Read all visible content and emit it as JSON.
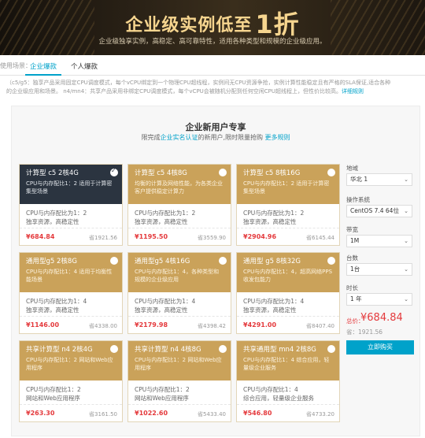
{
  "banner": {
    "headline": "企业级实例低至",
    "headline_big": "1折",
    "subtitle": "企业级独享实例，高稳定、高可靠特性，适用各种类型和规模的企业级应用。"
  },
  "tabs": {
    "prefix": "使用场景：",
    "items": [
      {
        "label": "企业爆款"
      },
      {
        "label": "个人爆款"
      }
    ]
  },
  "notice": {
    "line1": "（c5/g5：独享产品采用固定CPU调度模式，每个vCPU绑定到一个物理CPU超线程，实例间无CPU资源争抢，实例计算性能稳定且有严格的SLA保证,适合各种",
    "line2": "的企业级应用和场景。 n4/mn4：共享产品采用非绑定CPU调度模式，每个vCPU会被随机分配到任何空闲CPU超线程上，但性价比较高。",
    "link": "详细规则"
  },
  "panel": {
    "title": "企业新用户专享",
    "sub_before": "限完成",
    "sub_link": "企业实名认证",
    "sub_after": "的新用户,限时限量抢购",
    "rules_link": "更多规则"
  },
  "cards": [
    {
      "name": "计算型 c5 2核4G",
      "desc": "CPU与内存配比1：2 适用于计算密集型场景",
      "spec1": "CPU与内存配比为1：2",
      "spec2": "独享资源，高稳定性",
      "price": "¥684.84",
      "orig": "省1921.56",
      "selected": true
    },
    {
      "name": "计算型 c5 4核8G",
      "desc": "均衡的计算及网络性能，为各类企业客户提供稳定计算力",
      "spec1": "CPU与内存配比为1：2",
      "spec2": "独享资源，高稳定性",
      "price": "¥1195.50",
      "orig": "省3559.90",
      "selected": false
    },
    {
      "name": "计算型 c5 8核16G",
      "desc": "CPU与内存配比1：2 适用于计算密集型场景",
      "spec1": "CPU与内存配比为1：2",
      "spec2": "独享资源，高稳定性",
      "price": "¥2904.96",
      "orig": "省6145.44",
      "selected": false
    },
    {
      "name": "通用型g5 2核8G",
      "desc": "CPU与内存配比1：4 适用于均衡性能场景",
      "spec1": "CPU与内存配比为1：4",
      "spec2": "独享资源，高稳定性",
      "price": "¥1146.00",
      "orig": "省4338.00",
      "selected": false
    },
    {
      "name": "通用型g5 4核16G",
      "desc": "CPU与内存配比1：4，各种类型和规模的企业级应用",
      "spec1": "CPU与内存配比为1：4",
      "spec2": "独享资源，高稳定性",
      "price": "¥2179.98",
      "orig": "省4398.42",
      "selected": false
    },
    {
      "name": "通用型 g5 8核32G",
      "desc": "CPU与内存配比1：4，超高网络PPS收发包能力",
      "spec1": "CPU与内存配比为1：4",
      "spec2": "独享资源，高稳定性",
      "price": "¥4291.00",
      "orig": "省8407.40",
      "selected": false
    },
    {
      "name": "共享计算型 n4 2核4G",
      "desc": "CPU与内存配比1：2 网站和Web应用程序",
      "spec1": "CPU与内存配比1：2",
      "spec2": "网站和Web应用程序",
      "price": "¥263.30",
      "orig": "省3161.50",
      "selected": false
    },
    {
      "name": "共享计算型 n4 4核8G",
      "desc": "CPU与内存配比1：2 网站和Web应用程序",
      "spec1": "CPU与内存配比1：2",
      "spec2": "网站和Web应用程序",
      "price": "¥1022.60",
      "orig": "省5433.40",
      "selected": false
    },
    {
      "name": "共享通用型 mn4 2核8G",
      "desc": "CPU与内存配比1：4 综合应用，轻量级企业服务",
      "spec1": "CPU与内存配比1：4",
      "spec2": "综合应用，轻量级企业服务",
      "price": "¥546.80",
      "orig": "省4733.20",
      "selected": false
    }
  ],
  "options": {
    "region_label": "地域",
    "region_value": "华北 1",
    "os_label": "操作系统",
    "os_value": "CentOS 7.4 64位",
    "bandwidth_label": "带宽",
    "bandwidth_value": "1M",
    "quantity_label": "台数",
    "quantity_value": "1台",
    "duration_label": "时长",
    "duration_value": "1 年"
  },
  "total": {
    "label": "总价：",
    "value": "¥684.84",
    "saved": "省：1921.56"
  },
  "buy_label": "立即购买",
  "colors": {
    "accent": "#00a2ca",
    "card_gold": "#caa25a",
    "card_selected": "#2b3440",
    "price_red": "#e4393c"
  }
}
